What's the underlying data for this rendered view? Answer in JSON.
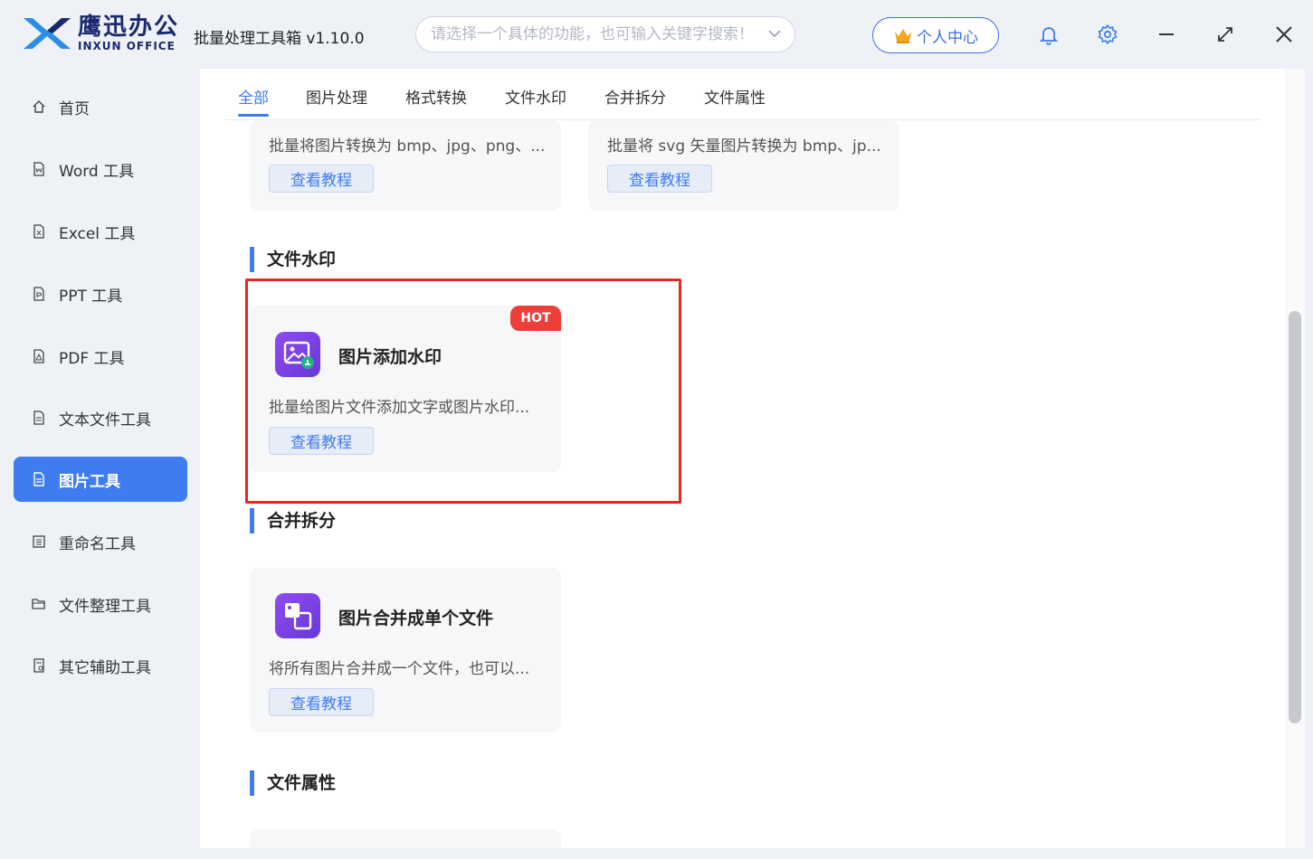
{
  "app": {
    "brand_cn": "鹰迅办公",
    "brand_en": "INXUN OFFICE",
    "title": "批量处理工具箱 v1.10.0"
  },
  "search": {
    "placeholder": "请选择一个具体的功能，也可输入关键字搜索！"
  },
  "header": {
    "user_center": "个人中心"
  },
  "sidebar": {
    "items": [
      {
        "label": "首页",
        "icon": "home-icon"
      },
      {
        "label": "Word 工具",
        "icon": "word-file-icon"
      },
      {
        "label": "Excel 工具",
        "icon": "excel-file-icon"
      },
      {
        "label": "PPT 工具",
        "icon": "ppt-file-icon"
      },
      {
        "label": "PDF 工具",
        "icon": "pdf-file-icon"
      },
      {
        "label": "文本文件工具",
        "icon": "text-file-icon"
      },
      {
        "label": "图片工具",
        "icon": "image-file-icon",
        "active": true
      },
      {
        "label": "重命名工具",
        "icon": "rename-icon"
      },
      {
        "label": "文件整理工具",
        "icon": "folder-icon"
      },
      {
        "label": "其它辅助工具",
        "icon": "misc-tools-icon"
      }
    ]
  },
  "tabs": [
    "全部",
    "图片处理",
    "格式转换",
    "文件水印",
    "合并拆分",
    "文件属性"
  ],
  "active_tab": "全部",
  "cards_top": [
    {
      "desc": "批量将图片转换为 bmp、jpg、png、...",
      "button": "查看教程"
    },
    {
      "desc": "批量将 svg 矢量图片转换为 bmp、jp...",
      "button": "查看教程"
    }
  ],
  "sections": {
    "watermark": {
      "title": "文件水印",
      "card": {
        "title": "图片添加水印",
        "desc": "批量给图片文件添加文字或图片水印...",
        "button": "查看教程",
        "badge": "HOT"
      }
    },
    "merge": {
      "title": "合并拆分",
      "card": {
        "title": "图片合并成单个文件",
        "desc": "将所有图片合并成一个文件，也可以...",
        "button": "查看教程"
      }
    },
    "props": {
      "title": "文件属性"
    }
  },
  "colors": {
    "accent": "#3f7cf0",
    "highlight": "#e8261e",
    "hot": "#ee3e3a"
  }
}
